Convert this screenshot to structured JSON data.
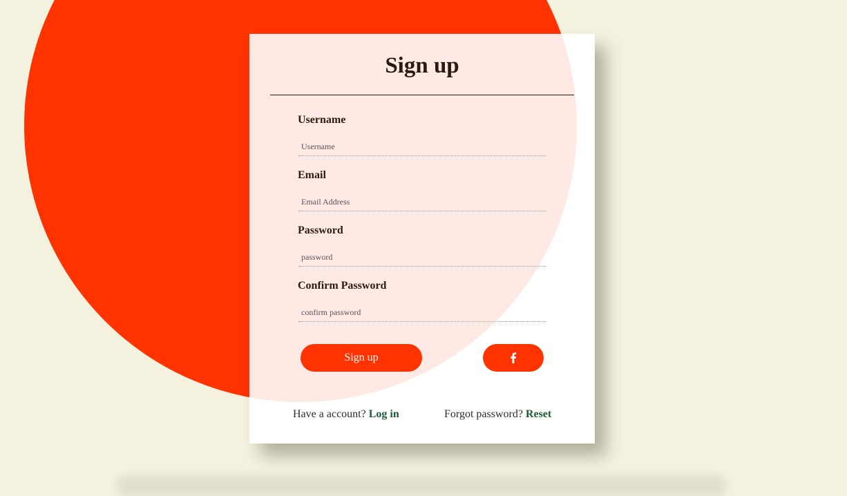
{
  "form": {
    "title": "Sign up",
    "fields": [
      {
        "label": "Username",
        "placeholder": "Username",
        "value": ""
      },
      {
        "label": "Email",
        "placeholder": "Email Address",
        "value": ""
      },
      {
        "label": "Password",
        "placeholder": "password",
        "value": ""
      },
      {
        "label": "Confirm Password",
        "placeholder": "confirm password",
        "value": ""
      }
    ],
    "signup_button_label": "Sign up",
    "facebook_icon": "facebook-icon"
  },
  "footer": {
    "account_prompt": "Have a account?",
    "login_link": "Log in",
    "forgot_prompt": "Forgot password?",
    "reset_link": "Reset"
  },
  "colors": {
    "background": "#f4f2de",
    "accent": "#ff3300",
    "card_tint": "#ffe9e4",
    "link": "#1d5a3a"
  }
}
